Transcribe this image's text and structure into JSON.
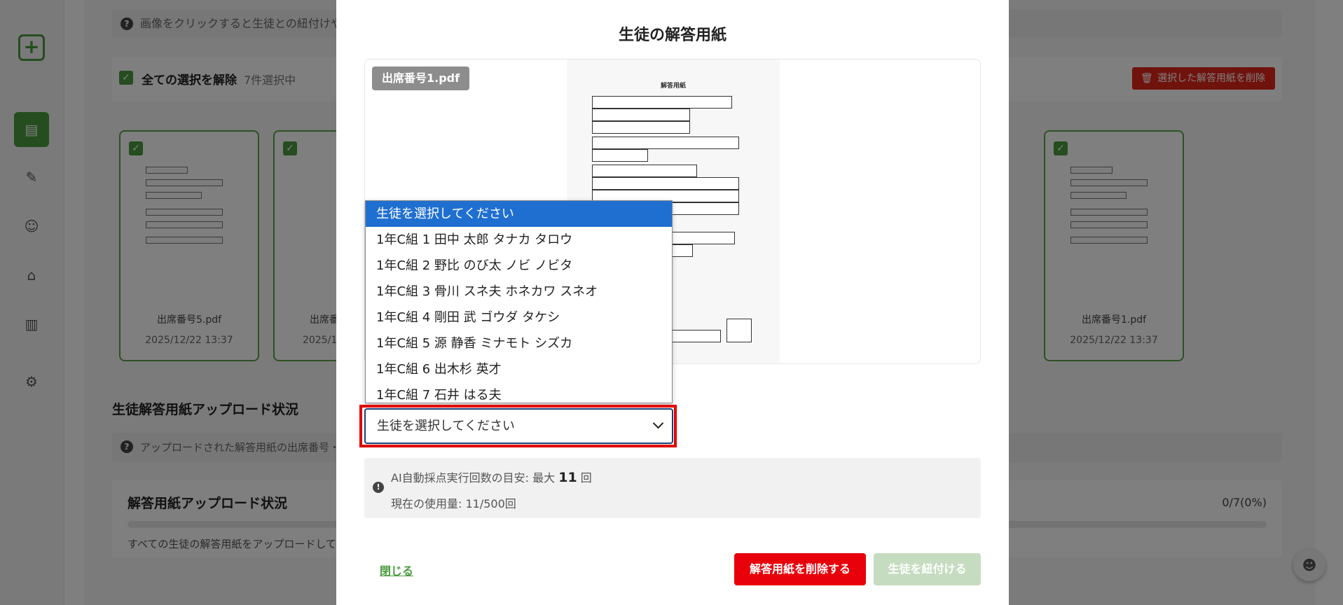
{
  "background": {
    "hint_text": "画像をクリックすると生徒との紐付けや削",
    "select_all_label": "全ての選択を解除",
    "selected_count": "7件選択中",
    "delete_selected_label": "選択した解答用紙を削除",
    "cards": [
      {
        "name": "出席番号5.pdf",
        "date": "2025/12/22 13:37"
      },
      {
        "name": "出席番",
        "date": "2025/1"
      },
      {
        "name": "出席番号1.pdf",
        "date": "2025/12/22 13:37"
      }
    ],
    "upload_section_title": "生徒解答用紙アップロード状況",
    "upload_hint": "アップロードされた解答用紙の出席番号・",
    "status_title": "解答用紙アップロード状況",
    "status_percent": "0/7(0%)",
    "progress_fraction": 0,
    "status_note": "すべての生徒の解答用紙をアップロードしてく"
  },
  "modal": {
    "title": "生徒の解答用紙",
    "file_badge": "出席番号1.pdf",
    "paper_title": "解答用紙",
    "dropdown_options": [
      "生徒を選択してください",
      "1年C組 1 田中 太郎 タナカ タロウ",
      "1年C組 2 野比 のび太 ノビ ノビタ",
      "1年C組 3 骨川 スネ夫 ホネカワ スネオ",
      "1年C組 4 剛田 武 ゴウダ タケシ",
      "1年C組 5 源 静香 ミナモト シズカ",
      "1年C組 6 出木杉 英才",
      "1年C組 7 石井 はる夫"
    ],
    "select_value": "生徒を選択してください",
    "ai_label": "AI自動採点実行回数の目安: 最大",
    "ai_count": "11",
    "ai_unit": "回",
    "usage_text": "現在の使用量: 11/500回",
    "close_label": "閉じる",
    "delete_label": "解答用紙を削除する",
    "link_label": "生徒を紐付ける"
  },
  "colors": {
    "brand_green": "#4b9a3e",
    "danger_red": "#e8000b",
    "select_highlight": "#1f6fd1"
  }
}
